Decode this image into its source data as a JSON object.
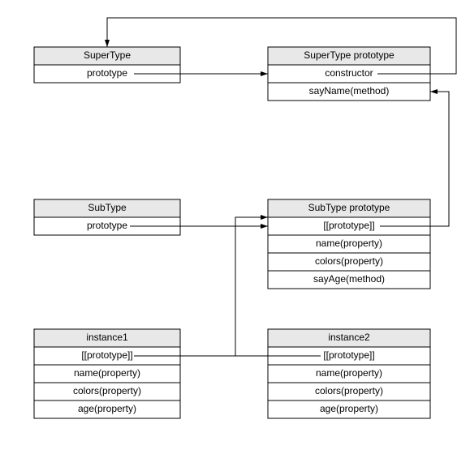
{
  "boxes": {
    "supertype": {
      "header": "SuperType",
      "rows": [
        "prototype"
      ]
    },
    "supertype_proto": {
      "header": "SuperType prototype",
      "rows": [
        "constructor",
        "sayName(method)"
      ]
    },
    "subtype": {
      "header": "SubType",
      "rows": [
        "prototype"
      ]
    },
    "subtype_proto": {
      "header": "SubType prototype",
      "rows": [
        "[[prototype]]",
        "name(property)",
        "colors(property)",
        "sayAge(method)"
      ]
    },
    "instance1": {
      "header": "instance1",
      "rows": [
        "[[prototype]]",
        "name(property)",
        "colors(property)",
        "age(property)"
      ]
    },
    "instance2": {
      "header": "instance2",
      "rows": [
        "[[prototype]]",
        "name(property)",
        "colors(property)",
        "age(property)"
      ]
    }
  }
}
